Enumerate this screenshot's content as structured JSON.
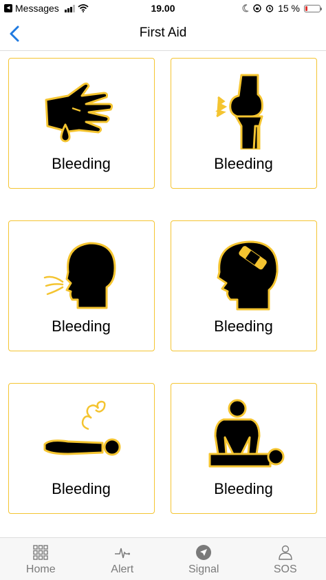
{
  "status_bar": {
    "carrier": "Messages",
    "time": "19.00",
    "battery": "15 %",
    "battery_level": 0.15
  },
  "nav": {
    "title": "First Aid",
    "back_icon": "chevron-left-icon"
  },
  "colors": {
    "accent_yellow": "#f4c430",
    "ios_blue": "#1f7ae0",
    "battery_red": "#e0302b"
  },
  "cards": [
    {
      "label": "Bleeding",
      "icon": "bleeding-hand-icon"
    },
    {
      "label": "Bleeding",
      "icon": "knee-injury-icon"
    },
    {
      "label": "Bleeding",
      "icon": "choking-head-icon"
    },
    {
      "label": "Bleeding",
      "icon": "head-bandage-icon"
    },
    {
      "label": "Bleeding",
      "icon": "fainting-person-icon"
    },
    {
      "label": "Bleeding",
      "icon": "cpr-icon"
    }
  ],
  "tabs": [
    {
      "label": "Home",
      "icon": "grid-icon"
    },
    {
      "label": "Alert",
      "icon": "heartbeat-icon"
    },
    {
      "label": "Signal",
      "icon": "location-arrow-icon"
    },
    {
      "label": "SOS",
      "icon": "person-icon"
    }
  ]
}
